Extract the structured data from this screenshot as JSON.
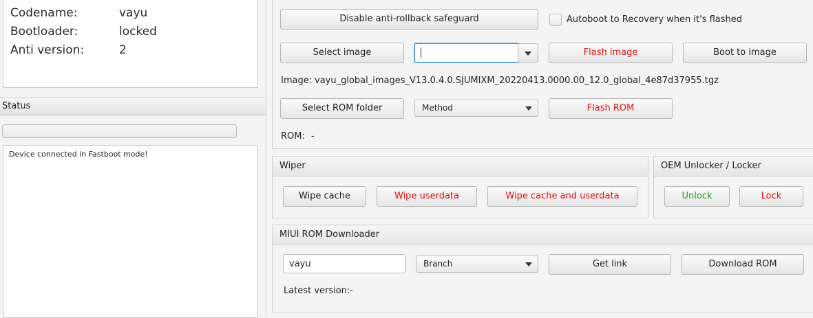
{
  "device_info": {
    "rows": [
      {
        "key": "Codename:",
        "value": "vayu"
      },
      {
        "key": "Bootloader:",
        "value": "locked"
      },
      {
        "key": "Anti version:",
        "value": "2"
      }
    ]
  },
  "status": {
    "title": "Status",
    "progress_percent": 0,
    "log": "Device connected in Fastboot mode!"
  },
  "flasher": {
    "disable_antirollback_label": "Disable anti-rollback safeguard",
    "autoboot_label": "Autoboot to Recovery when it's flashed",
    "select_image_label": "Select image",
    "partition_combo_value": "",
    "flash_image_label": "Flash image",
    "boot_image_label": "Boot to image",
    "image_label": "Image:",
    "image_value": "vayu_global_images_V13.0.4.0.SJUMIXM_20220413.0000.00_12.0_global_4e87d37955.tgz",
    "select_rom_folder_label": "Select ROM folder",
    "method_value": "Method",
    "flash_rom_label": "Flash ROM",
    "rom_label": "ROM:",
    "rom_value": "-"
  },
  "wiper": {
    "title": "Wiper",
    "wipe_cache_label": "Wipe cache",
    "wipe_userdata_label": "Wipe userdata",
    "wipe_cache_userdata_label": "Wipe cache and userdata"
  },
  "oem": {
    "title": "OEM Unlocker / Locker",
    "unlock_label": "Unlock",
    "lock_label": "Lock"
  },
  "downloader": {
    "title": "MIUI ROM Downloader",
    "codename_value": "vayu",
    "branch_value": "Branch",
    "get_link_label": "Get link",
    "download_label": "Download ROM",
    "latest_label": "Latest version:",
    "latest_value": "-"
  },
  "colors": {
    "danger": "#e01010",
    "success": "#19a319",
    "background": "#f4f4f4"
  },
  "icons": {
    "combo_arrow": "chevron-down-icon"
  }
}
